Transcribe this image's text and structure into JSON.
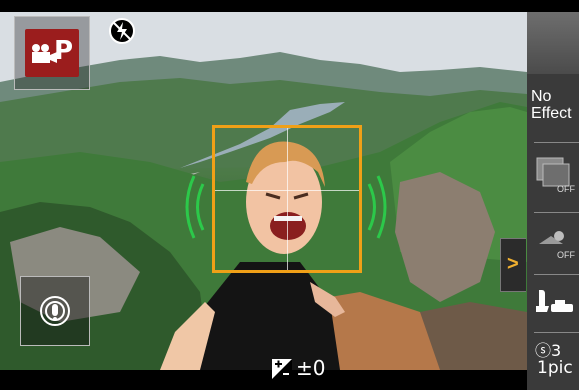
{
  "mode": {
    "label": "P",
    "accent": "#9b1d1d"
  },
  "flash": {
    "icon": "flash-off-icon"
  },
  "focus": {
    "color": "#f0a017"
  },
  "exposure": {
    "icon": "exposure-compensation-icon",
    "value": "±0"
  },
  "side_panel": {
    "effect_label_line1": "No",
    "effect_label_line2": "Effect",
    "items": [
      {
        "icon": "filter-off-icon",
        "badge": "OFF"
      },
      {
        "icon": "defocus-off-icon",
        "badge": "OFF"
      },
      {
        "icon": "shutter-touch-icon"
      }
    ],
    "expand_arrow": ">",
    "self_timer": "ⓢ3",
    "pic_count": "1pic"
  },
  "touch_button": {
    "icon": "touch-af-icon"
  }
}
